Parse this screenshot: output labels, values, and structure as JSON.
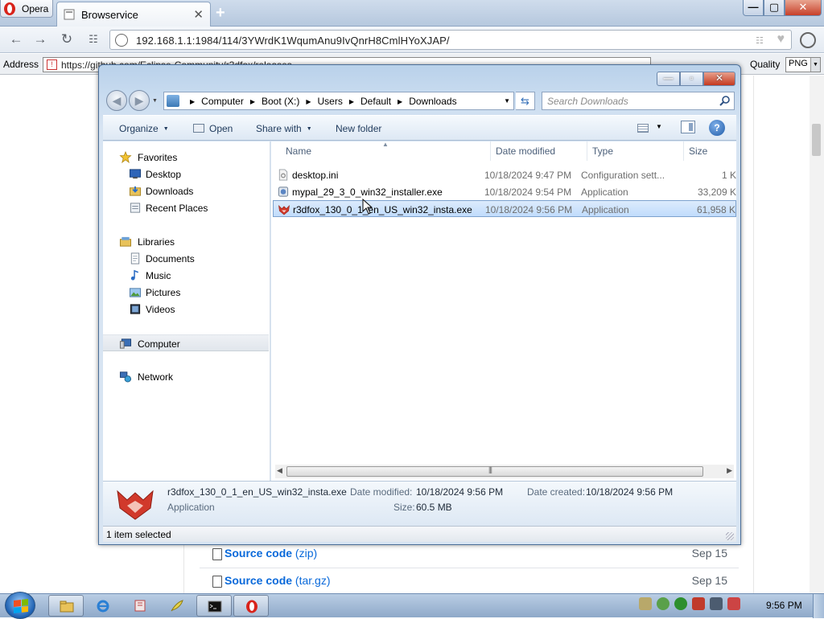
{
  "browser": {
    "menu_label": "Opera",
    "tab_title": "Browservice",
    "tab_close": "✕",
    "new_tab": "+",
    "url": "192.168.1.1:1984/114/3YWrdK1WqumAnu9IvQnrH8CmlHYoXJAP/",
    "window_controls": {
      "minimize": "—",
      "maximize": "▢",
      "close": "✕"
    }
  },
  "browservice_bar": {
    "address_label": "Address",
    "address_value": "https://github.com/Eclipse-Community/r3dfox/releases",
    "quality_label": "Quality",
    "quality_value": "PNG"
  },
  "page": {
    "assets": [
      {
        "name": "Source code",
        "ext": "(zip)",
        "date": "Sep 15"
      },
      {
        "name": "Source code",
        "ext": "(tar.gz)",
        "date": "Sep 15"
      }
    ]
  },
  "explorer": {
    "breadcrumb": [
      "Computer",
      "Boot (X:)",
      "Users",
      "Default",
      "Downloads"
    ],
    "search_placeholder": "Search Downloads",
    "toolbar": {
      "organize": "Organize",
      "open": "Open",
      "share_with": "Share with",
      "new_folder": "New folder",
      "help": "?"
    },
    "nav": {
      "favorites": "Favorites",
      "favorites_items": [
        "Desktop",
        "Downloads",
        "Recent Places"
      ],
      "libraries": "Libraries",
      "libraries_items": [
        "Documents",
        "Music",
        "Pictures",
        "Videos"
      ],
      "computer": "Computer",
      "network": "Network"
    },
    "columns": {
      "name": "Name",
      "date_modified": "Date modified",
      "type": "Type",
      "size": "Size"
    },
    "files": [
      {
        "name": "desktop.ini",
        "date": "10/18/2024 9:47 PM",
        "type": "Configuration sett...",
        "size": "1 K",
        "icon": "ini-file-icon",
        "selected": false
      },
      {
        "name": "mypal_29_3_0_win32_installer.exe",
        "date": "10/18/2024 9:54 PM",
        "type": "Application",
        "size": "33,209 K",
        "icon": "mypal-installer-icon",
        "selected": false
      },
      {
        "name": "r3dfox_130_0_1_en_US_win32_insta.exe",
        "date": "10/18/2024 9:56 PM",
        "type": "Application",
        "size": "61,958 K",
        "icon": "r3dfox-icon",
        "selected": true
      }
    ],
    "details": {
      "filename": "r3dfox_130_0_1_en_US_win32_insta.exe",
      "type": "Application",
      "date_modified_label": "Date modified:",
      "date_modified": "10/18/2024 9:56 PM",
      "date_created_label": "Date created:",
      "date_created": "10/18/2024 9:56 PM",
      "size_label": "Size:",
      "size": "60.5 MB"
    },
    "status": "1 item selected"
  },
  "taskbar": {
    "clock": "9:56 PM"
  },
  "colors": {
    "accent": "#3c78b5",
    "link": "#0969da",
    "selection": "#c1dcfc",
    "r3dfox_red": "#d1392b"
  }
}
